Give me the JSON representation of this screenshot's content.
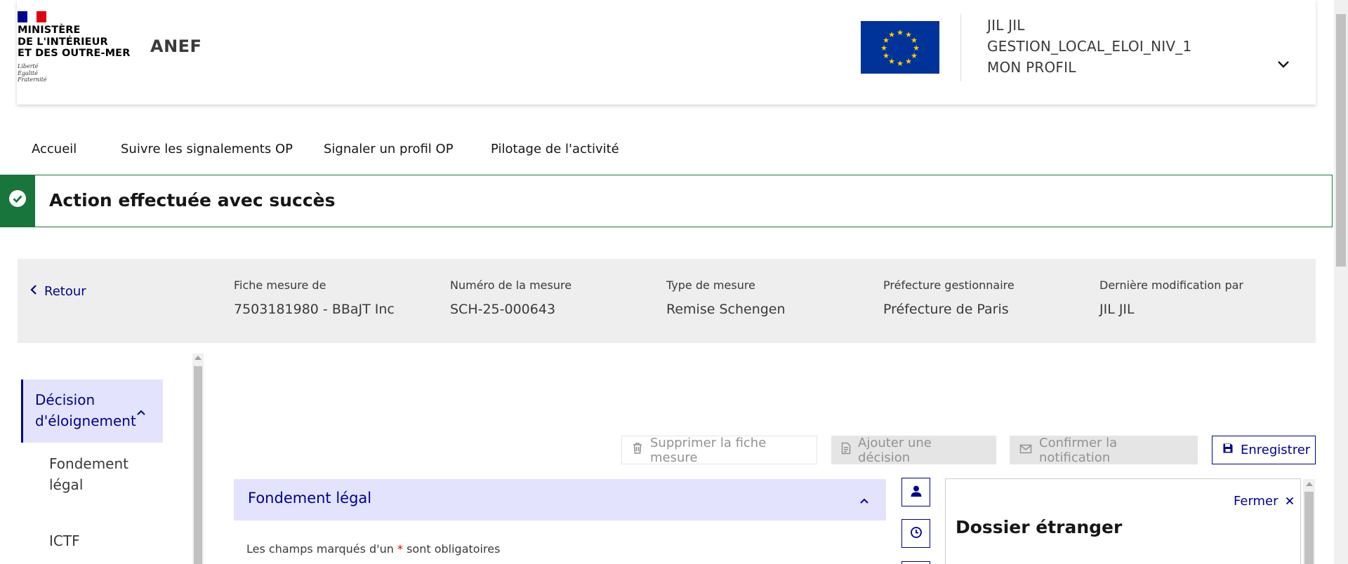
{
  "header": {
    "ministry_lines": [
      "MINISTÈRE",
      "DE L'INTÉRIEUR",
      "ET DES OUTRE-MER"
    ],
    "motto_lines": [
      "Liberté",
      "Égalité",
      "Fraternité"
    ],
    "app_name": "ANEF",
    "user": {
      "name": "JIL JIL",
      "role": "GESTION_LOCAL_ELOI_NIV_1",
      "profile_link": "MON PROFIL"
    },
    "colors": {
      "flag_blue": "#000091",
      "flag_white": "#ffffff",
      "flag_red": "#e1000f",
      "eu_blue": "#003399",
      "eu_star": "#ffcc00"
    }
  },
  "nav": {
    "items": [
      "Accueil",
      "Suivre les signalements OP",
      "Signaler un profil OP",
      "Pilotage de l'activité"
    ]
  },
  "alert": {
    "message": "Action effectuée avec succès",
    "color": "#18753c"
  },
  "info": {
    "back_label": "Retour",
    "fields": [
      {
        "label": "Fiche mesure de",
        "value": "7503181980 - BBaJT Inc"
      },
      {
        "label": "Numéro de la mesure",
        "value": "SCH-25-000643"
      },
      {
        "label": "Type de mesure",
        "value": "Remise Schengen"
      },
      {
        "label": "Préfecture gestionnaire",
        "value": "Préfecture de Paris"
      },
      {
        "label": "Dernière modification par",
        "value": "JIL JIL"
      }
    ]
  },
  "sidebar": {
    "active": "Décision d'éloignement",
    "items": [
      "Fondement légal",
      "ICTF"
    ]
  },
  "actions": {
    "delete": "Supprimer la fiche mesure",
    "add_decision": "Ajouter une décision",
    "confirm_notification": "Confirmer la notification",
    "save": "Enregistrer"
  },
  "form": {
    "section_title": "Fondement légal",
    "required_note_before": "Les champs marqués d'un ",
    "required_star": "*",
    "required_note_after": " sont obligatoires"
  },
  "panel": {
    "close_label": "Fermer",
    "title": "Dossier étranger"
  },
  "icons": [
    "user-icon",
    "clock-icon",
    "trash-icon",
    "document-icon",
    "mail-icon",
    "save-icon",
    "close-icon",
    "chevron-left-icon",
    "chevron-up-icon",
    "chevron-down-icon",
    "check-circle-icon"
  ]
}
